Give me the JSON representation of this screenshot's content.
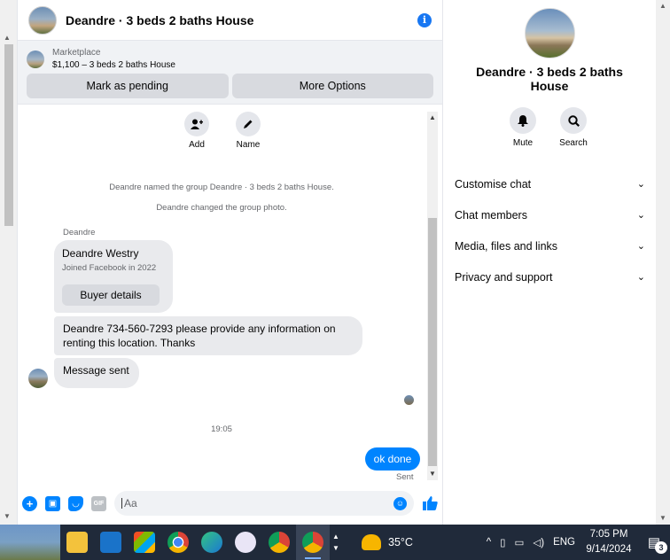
{
  "conversation": {
    "title": "Deandre · 3 beds 2 baths House",
    "info_icon": "info-icon"
  },
  "marketplace": {
    "label": "Marketplace",
    "listing": "$1,100 – 3 beds 2 baths House",
    "mark_pending": "Mark as pending",
    "more_options": "More Options"
  },
  "quick_actions": [
    {
      "label": "Add",
      "icon": "add-person-icon"
    },
    {
      "label": "Name",
      "icon": "pencil-icon"
    }
  ],
  "system_messages": [
    "Deandre named the group Deandre · 3 beds 2 baths House.",
    "Deandre changed the group photo."
  ],
  "messages": {
    "sender_name": "Deandre",
    "card": {
      "name": "Deandre Westry",
      "sub": "Joined Facebook in 2022",
      "button": "Buyer details"
    },
    "message_1": "Deandre 734-560-7293 please provide any information on renting this location. Thanks",
    "message_2": "Message sent",
    "time": "19:05",
    "outgoing": "ok done",
    "outgoing_status": "Sent"
  },
  "composer": {
    "placeholder": "Aa",
    "gif_label": "GIF"
  },
  "panel": {
    "title": "Deandre · 3 beds 2 baths House",
    "actions": [
      {
        "label": "Mute",
        "icon": "bell-icon"
      },
      {
        "label": "Search",
        "icon": "search-icon"
      }
    ],
    "sections": [
      "Customise chat",
      "Chat members",
      "Media, files and links",
      "Privacy and support"
    ]
  },
  "taskbar": {
    "temperature": "35°C",
    "language": "ENG",
    "time": "7:05 PM",
    "date": "9/14/2024",
    "notifications": "3"
  }
}
